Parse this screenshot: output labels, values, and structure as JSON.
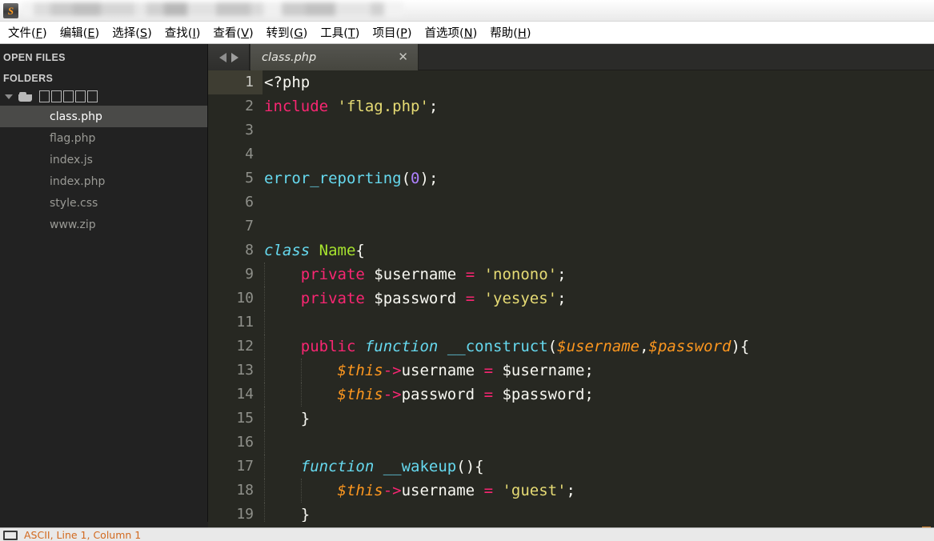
{
  "window": {
    "app_icon_glyph": "S",
    "title_redacted": true
  },
  "menubar": {
    "items": [
      {
        "label": "文件",
        "mnemonic": "F"
      },
      {
        "label": "编辑",
        "mnemonic": "E"
      },
      {
        "label": "选择",
        "mnemonic": "S"
      },
      {
        "label": "查找",
        "mnemonic": "I"
      },
      {
        "label": "查看",
        "mnemonic": "V"
      },
      {
        "label": "转到",
        "mnemonic": "G"
      },
      {
        "label": "工具",
        "mnemonic": "T"
      },
      {
        "label": "项目",
        "mnemonic": "P"
      },
      {
        "label": "首选项",
        "mnemonic": "N"
      },
      {
        "label": "帮助",
        "mnemonic": "H"
      }
    ]
  },
  "sidebar": {
    "open_files_header": "OPEN FILES",
    "folders_header": "FOLDERS",
    "folder": {
      "name": "□□□□□",
      "name_glyph_count": 5,
      "expanded": true
    },
    "files": [
      {
        "name": "class.php",
        "selected": true
      },
      {
        "name": "flag.php",
        "selected": false
      },
      {
        "name": "index.js",
        "selected": false
      },
      {
        "name": "index.php",
        "selected": false
      },
      {
        "name": "style.css",
        "selected": false
      },
      {
        "name": "www.zip",
        "selected": false
      }
    ]
  },
  "tabbar": {
    "nav_back": "◀",
    "nav_forward": "▶",
    "active_tab": "class.php",
    "close_glyph": "✕"
  },
  "editor": {
    "filename": "class.php",
    "language": "PHP",
    "first_visible_line": 1,
    "active_line": 1,
    "lines": [
      {
        "n": 1,
        "tokens": [
          {
            "t": "punc",
            "s": "<?php"
          }
        ]
      },
      {
        "n": 2,
        "tokens": [
          {
            "t": "key",
            "s": "include"
          },
          {
            "t": "plain",
            "s": " "
          },
          {
            "t": "str",
            "s": "'flag.php'"
          },
          {
            "t": "punc",
            "s": ";"
          }
        ]
      },
      {
        "n": 3,
        "tokens": []
      },
      {
        "n": 4,
        "tokens": []
      },
      {
        "n": 5,
        "tokens": [
          {
            "t": "fn",
            "s": "error_reporting"
          },
          {
            "t": "num-paren",
            "s": "("
          },
          {
            "t": "num",
            "s": "0"
          },
          {
            "t": "num-paren",
            "s": ")"
          },
          {
            "t": "punc",
            "s": ";"
          }
        ]
      },
      {
        "n": 6,
        "tokens": []
      },
      {
        "n": 7,
        "tokens": []
      },
      {
        "n": 8,
        "tokens": [
          {
            "t": "class",
            "s": "class"
          },
          {
            "t": "plain",
            "s": " "
          },
          {
            "t": "name",
            "s": "Name"
          },
          {
            "t": "punc",
            "s": "{"
          }
        ]
      },
      {
        "n": 9,
        "tokens": [
          {
            "t": "plain",
            "s": "    "
          },
          {
            "t": "key",
            "s": "private"
          },
          {
            "t": "plain",
            "s": " $username "
          },
          {
            "t": "key",
            "s": "="
          },
          {
            "t": "plain",
            "s": " "
          },
          {
            "t": "str",
            "s": "'nonono'"
          },
          {
            "t": "punc",
            "s": ";"
          }
        ]
      },
      {
        "n": 10,
        "tokens": [
          {
            "t": "plain",
            "s": "    "
          },
          {
            "t": "key",
            "s": "private"
          },
          {
            "t": "plain",
            "s": " $password "
          },
          {
            "t": "key",
            "s": "="
          },
          {
            "t": "plain",
            "s": " "
          },
          {
            "t": "str",
            "s": "'yesyes'"
          },
          {
            "t": "punc",
            "s": ";"
          }
        ]
      },
      {
        "n": 11,
        "tokens": []
      },
      {
        "n": 12,
        "tokens": [
          {
            "t": "plain",
            "s": "    "
          },
          {
            "t": "key",
            "s": "public"
          },
          {
            "t": "plain",
            "s": " "
          },
          {
            "t": "class",
            "s": "function"
          },
          {
            "t": "plain",
            "s": " "
          },
          {
            "t": "fn",
            "s": "__construct"
          },
          {
            "t": "punc",
            "s": "("
          },
          {
            "t": "var",
            "s": "$username"
          },
          {
            "t": "punc",
            "s": ","
          },
          {
            "t": "var",
            "s": "$password"
          },
          {
            "t": "punc",
            "s": "){"
          }
        ]
      },
      {
        "n": 13,
        "tokens": [
          {
            "t": "plain",
            "s": "        "
          },
          {
            "t": "var",
            "s": "$this"
          },
          {
            "t": "key",
            "s": "->"
          },
          {
            "t": "plain",
            "s": "username "
          },
          {
            "t": "key",
            "s": "="
          },
          {
            "t": "plain",
            "s": " $username"
          },
          {
            "t": "punc",
            "s": ";"
          }
        ]
      },
      {
        "n": 14,
        "tokens": [
          {
            "t": "plain",
            "s": "        "
          },
          {
            "t": "var",
            "s": "$this"
          },
          {
            "t": "key",
            "s": "->"
          },
          {
            "t": "plain",
            "s": "password "
          },
          {
            "t": "key",
            "s": "="
          },
          {
            "t": "plain",
            "s": " $password"
          },
          {
            "t": "punc",
            "s": ";"
          }
        ]
      },
      {
        "n": 15,
        "tokens": [
          {
            "t": "plain",
            "s": "    "
          },
          {
            "t": "punc",
            "s": "}"
          }
        ]
      },
      {
        "n": 16,
        "tokens": []
      },
      {
        "n": 17,
        "tokens": [
          {
            "t": "plain",
            "s": "    "
          },
          {
            "t": "class",
            "s": "function"
          },
          {
            "t": "plain",
            "s": " "
          },
          {
            "t": "fn",
            "s": "__wakeup"
          },
          {
            "t": "punc",
            "s": "(){"
          }
        ]
      },
      {
        "n": 18,
        "tokens": [
          {
            "t": "plain",
            "s": "        "
          },
          {
            "t": "var",
            "s": "$this"
          },
          {
            "t": "key",
            "s": "->"
          },
          {
            "t": "plain",
            "s": "username "
          },
          {
            "t": "key",
            "s": "="
          },
          {
            "t": "plain",
            "s": " "
          },
          {
            "t": "str",
            "s": "'guest'"
          },
          {
            "t": "punc",
            "s": ";"
          }
        ]
      },
      {
        "n": 19,
        "tokens": [
          {
            "t": "plain",
            "s": "    "
          },
          {
            "t": "punc",
            "s": "}"
          }
        ]
      }
    ]
  },
  "statusbar": {
    "text": "ASCII, Line 1, Column 1"
  },
  "colors": {
    "editor_bg": "#272822",
    "sidebar_bg": "#222222",
    "active_line_gutter": "#3e3d32",
    "keyword_pink": "#f92672",
    "string_yellow": "#e6db74",
    "function_cyan": "#66d9ef",
    "class_green": "#a6e22e",
    "number_purple": "#ae81ff",
    "variable_orange": "#fd971f",
    "foreground": "#f8f8f2",
    "gutter_fg": "#8f908a",
    "tab_active_bg": "#4e4e48",
    "selected_file_bg": "#4a4a48"
  }
}
